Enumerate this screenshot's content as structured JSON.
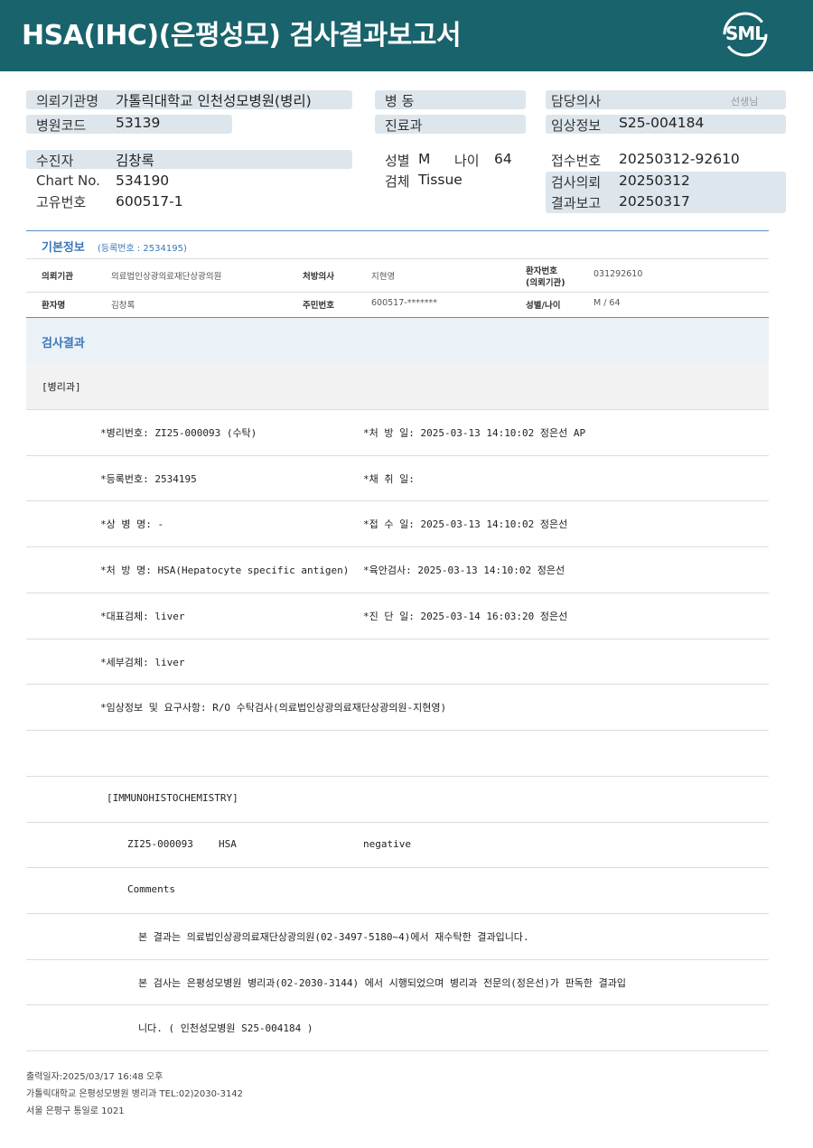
{
  "header": {
    "title": "HSA(IHC)(은평성모) 검사결과보고서",
    "logo_text": "SML"
  },
  "top_fields": {
    "requester_label": "의뢰기관명",
    "requester_value": "가톨릭대학교 인천성모병원(병리)",
    "hospital_code_label": "병원코드",
    "hospital_code_value": "53139",
    "ward_label": "병  동",
    "dept_label": "진료과",
    "doctor_label": "담당의사",
    "doctor_suffix": "선생님",
    "clinical_label": "임상정보",
    "clinical_value": "S25-004184",
    "patient_label": "수진자",
    "patient_value": "김창록",
    "chart_label": "Chart No.",
    "chart_value": "534190",
    "unique_label": "고유번호",
    "unique_value": "600517-1",
    "sex_label": "성별",
    "sex_value": "M",
    "age_label": "나이",
    "age_value": "64",
    "specimen_label": "검체",
    "specimen_value": "Tissue",
    "receipt_label": "접수번호",
    "receipt_value": "20250312-92610",
    "request_label": "검사의뢰",
    "request_value": "20250312",
    "report_label": "결과보고",
    "report_value": "20250317"
  },
  "basic_info": {
    "title": "기본정보",
    "reg_no": "(등록번호 : 2534195)",
    "inst_label": "의뢰기관",
    "inst_value": "의료법인상광의료재단상광의원",
    "rx_doctor_label": "처방의사",
    "rx_doctor_value": "지현영",
    "patient_no_label_1": "환자번호",
    "patient_no_label_2": "(의뢰기관)",
    "patient_no_value": "031292610",
    "name_label": "환자명",
    "name_value": "김창록",
    "rrn_label": "주민번호",
    "rrn_value": "600517-*******",
    "sexage_label": "성별/나이",
    "sexage_value": "M / 64"
  },
  "results": {
    "title": "검사결과",
    "dept": "[병리과]",
    "rows": [
      {
        "left": "*병리번호: ZI25-000093 (수탁)",
        "right": "*처 방 일: 2025-03-13 14:10:02  정은선 AP"
      },
      {
        "left": "*등록번호: 2534195",
        "right": "*채 취 일:"
      },
      {
        "left": "*상 병 명: -",
        "right": "*접 수 일: 2025-03-13 14:10:02  정은선"
      },
      {
        "left": "*처 방 명: HSA(Hepatocyte specific antigen)",
        "right": "*육안검사: 2025-03-13 14:10:02  정은선"
      },
      {
        "left": "*대표검체: liver",
        "right": "*진 단 일: 2025-03-14 16:03:20  정은선"
      },
      {
        "left": "*세부검체: liver",
        "right": ""
      },
      {
        "left": "*임상정보 및 요구사항: R/O 수탁검사(의료법인상광의료재단상광의원-지현영)",
        "right": ""
      }
    ],
    "ihc_header": "[IMMUNOHISTOCHEMISTRY]",
    "ihc_id": "ZI25-000093",
    "ihc_marker": "HSA",
    "ihc_result": "negative",
    "comments_label": "Comments",
    "comment_1": "본 결과는 의료법인상광의료재단상광의원(02-3497-5180~4)에서 재수탁한 결과입니다.",
    "comment_2": "본 검사는 은평성모병원 병리과(02-2030-3144) 에서 시행되었으며 병리과 전문의(정은선)가 판독한 결과입",
    "comment_3": "니다. ( 인천성모병원 S25-004184 )"
  },
  "footer": {
    "printed": "출력일자:2025/03/17 16:48 오후",
    "lab": "가톨릭대학교 은평성모병원 병리과 TEL:02)2030-3142",
    "address": "서울 은평구 통일로 1021"
  },
  "colors": {
    "banner": "#19636c",
    "label_box": "#dde6ec",
    "section_blue": "#3a78b8"
  }
}
